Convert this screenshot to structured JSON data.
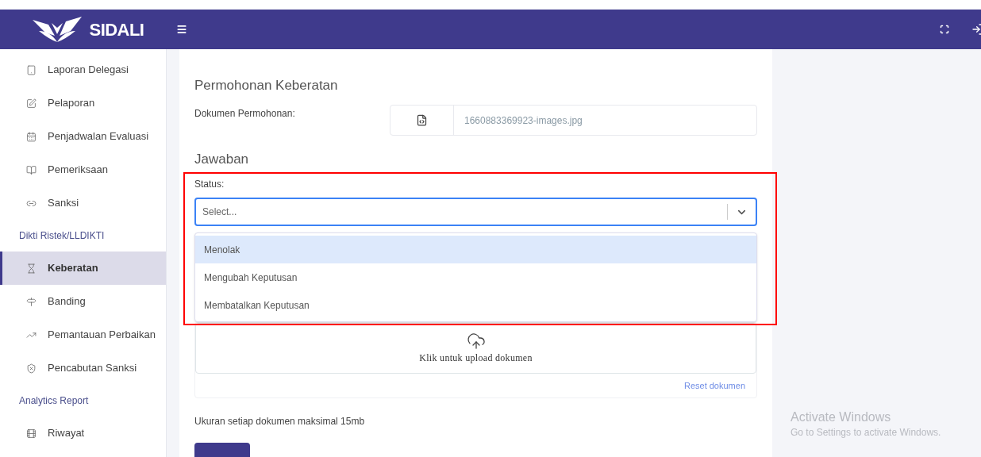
{
  "header": {
    "brand": "SIDALI"
  },
  "sidebar": {
    "sections": [
      {
        "items": [
          {
            "label": "Laporan Delegasi",
            "selected": false
          },
          {
            "label": "Pelaporan",
            "selected": false
          },
          {
            "label": "Penjadwalan Evaluasi",
            "selected": false
          },
          {
            "label": "Pemeriksaan",
            "selected": false
          },
          {
            "label": "Sanksi",
            "selected": false
          }
        ]
      },
      {
        "title": "Dikti Ristek/LLDIKTI",
        "items": [
          {
            "label": "Keberatan",
            "selected": true
          },
          {
            "label": "Banding",
            "selected": false
          },
          {
            "label": "Pemantauan Perbaikan",
            "selected": false
          },
          {
            "label": "Pencabutan Sanksi",
            "selected": false
          }
        ]
      },
      {
        "title": "Analytics Report",
        "items": [
          {
            "label": "Riwayat",
            "selected": false
          }
        ]
      }
    ]
  },
  "request": {
    "heading": "Permohonan Keberatan",
    "document_label": "Dokumen Permohonan:",
    "file_name": "1660883369923-images.jpg"
  },
  "answer": {
    "heading": "Jawaban",
    "status_label": "Status:",
    "status_placeholder": "Select...",
    "options": [
      {
        "label": "Menolak",
        "selected": true
      },
      {
        "label": "Mengubah Keputusan",
        "selected": false
      },
      {
        "label": "Membatalkan Keputusan",
        "selected": false
      }
    ],
    "upload_text": "Klik untuk upload dokumen",
    "reset_link": "Reset dokumen",
    "size_note": "Ukuran setiap dokumen maksimal 15mb"
  },
  "os_overlay": {
    "title": "Activate Windows",
    "subtitle": "Go to Settings to activate Windows."
  }
}
